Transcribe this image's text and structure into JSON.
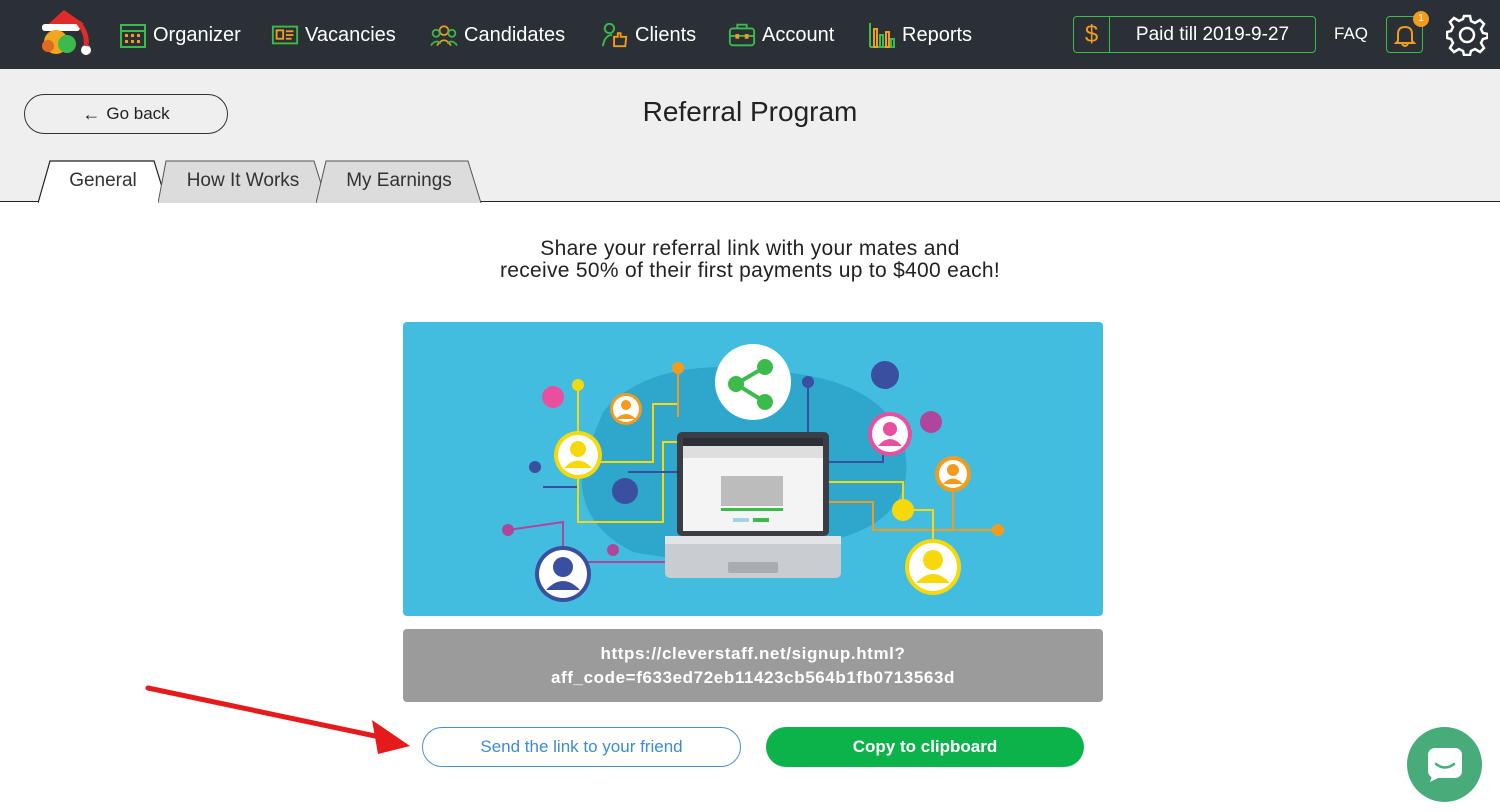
{
  "nav": {
    "items": [
      {
        "label": "Organizer",
        "icon": "calendar-icon"
      },
      {
        "label": "Vacancies",
        "icon": "vacancies-card-icon"
      },
      {
        "label": "Candidates",
        "icon": "people-group-icon"
      },
      {
        "label": "Clients",
        "icon": "client-handshake-icon"
      },
      {
        "label": "Account",
        "icon": "briefcase-icon"
      },
      {
        "label": "Reports",
        "icon": "bar-chart-icon"
      }
    ],
    "paid_symbol": "$",
    "paid_label": "Paid till 2019-9-27",
    "faq_label": "FAQ",
    "notification_count": "1"
  },
  "header": {
    "back_label": "Go back",
    "title": "Referral Program",
    "tabs": [
      {
        "label": "General",
        "active": true
      },
      {
        "label": "How It Works",
        "active": false
      },
      {
        "label": "My Earnings",
        "active": false
      }
    ]
  },
  "content": {
    "headline_line1": "Share your referral link with your mates and",
    "headline_line2": "receive 50% of their first payments up to $400 each!",
    "link_line1": "https://cleverstaff.net/signup.html?",
    "link_line2": "aff_code=f633ed72eb11423cb564b1fb0713563d",
    "send_button": "Send the link to your friend",
    "copy_button": "Copy to clipboard"
  },
  "colors": {
    "topbar": "#2b3036",
    "accent_green": "#3bbb4b",
    "orange": "#f29b1d",
    "illustration_bg": "#42bde0",
    "copy_button": "#0bb34a",
    "send_button_text": "#3d8ad6",
    "chat_button": "#47ac7a"
  }
}
